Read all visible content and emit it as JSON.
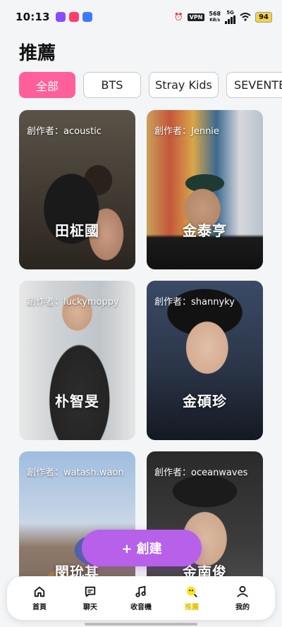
{
  "status": {
    "time": "10:13",
    "vpn": "VPN",
    "speed_value": "568",
    "speed_unit": "KB/s",
    "network": "5G",
    "battery": "94"
  },
  "page": {
    "title": "推薦"
  },
  "chips": [
    {
      "label": "全部",
      "active": true
    },
    {
      "label": "BTS",
      "active": false
    },
    {
      "label": "Stray Kids",
      "active": false
    },
    {
      "label": "SEVENTEEN",
      "active": false
    }
  ],
  "cards": [
    {
      "creator": "創作者：acoustic",
      "name": "田柾國"
    },
    {
      "creator": "創作者：Jennie",
      "name": "金泰亨"
    },
    {
      "creator": "創作者：luckymoppy",
      "name": "朴智旻"
    },
    {
      "creator": "創作者：shannyky",
      "name": "金碩珍"
    },
    {
      "creator": "創作者：watash.waon",
      "name": "閔玧其"
    },
    {
      "creator": "創作者：oceanwaves",
      "name": "金南俊"
    }
  ],
  "create_button": {
    "label": "+ 創建"
  },
  "nav": [
    {
      "label": "首頁",
      "icon": "home-icon"
    },
    {
      "label": "聊天",
      "icon": "chat-icon"
    },
    {
      "label": "收音機",
      "icon": "music-icon"
    },
    {
      "label": "推薦",
      "icon": "recommend-icon",
      "active": true
    },
    {
      "label": "我的",
      "icon": "profile-icon"
    }
  ],
  "colors": {
    "accent_chip": "#ff5f9b",
    "create_button": "#b760ea",
    "nav_active": "#e3c200"
  }
}
